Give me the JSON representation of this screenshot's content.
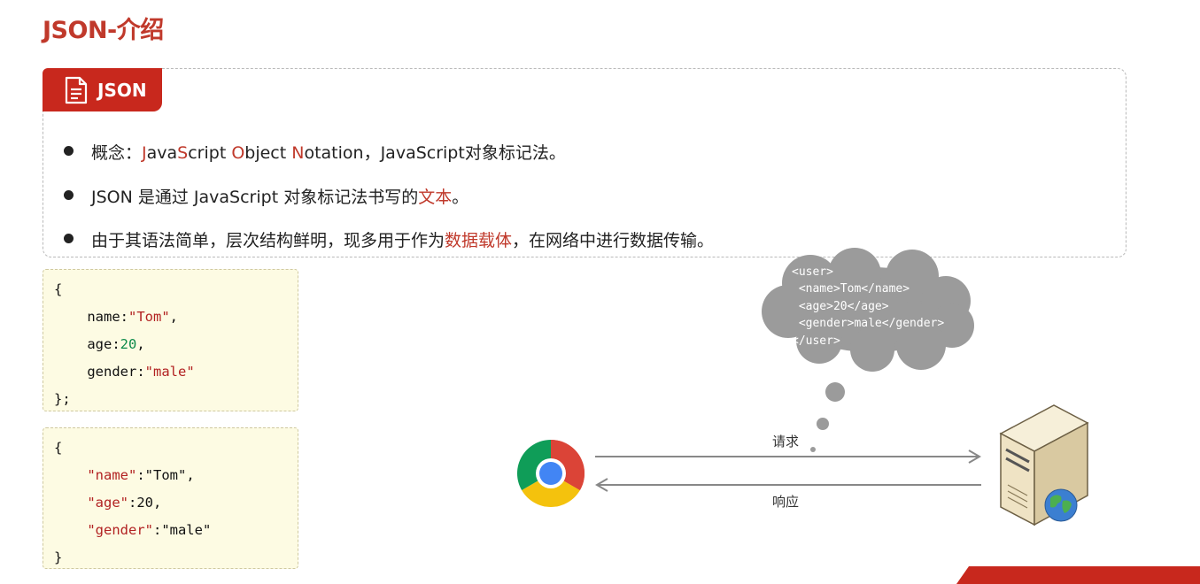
{
  "page": {
    "title": "JSON-介绍"
  },
  "concept_card": {
    "tag_label": "JSON",
    "tag_icon": "document-icon",
    "accent_color": "#c8281d",
    "bullets": [
      {
        "parts": [
          {
            "text": "概念：",
            "red": false
          },
          {
            "text": "J",
            "red": true
          },
          {
            "text": "ava",
            "red": false
          },
          {
            "text": "S",
            "red": true
          },
          {
            "text": "cript ",
            "red": false
          },
          {
            "text": "O",
            "red": true
          },
          {
            "text": "bject ",
            "red": false
          },
          {
            "text": "N",
            "red": true
          },
          {
            "text": "otation，JavaScript对象标记法。",
            "red": false
          }
        ]
      },
      {
        "parts": [
          {
            "text": "JSON 是通过 JavaScript 对象标记法书写的",
            "red": false
          },
          {
            "text": "文本",
            "red": true
          },
          {
            "text": "。",
            "red": false
          }
        ]
      },
      {
        "parts": [
          {
            "text": "由于其语法简单，层次结构鲜明，现多用于作为",
            "red": false
          },
          {
            "text": "数据载体",
            "red": true
          },
          {
            "text": "，在网络中进行数据传输。",
            "red": false
          }
        ]
      }
    ]
  },
  "js_object_code": {
    "lines": [
      [
        {
          "t": "{",
          "c": "plain"
        }
      ],
      [
        {
          "t": "    name:",
          "c": "plain"
        },
        {
          "t": "\"Tom\"",
          "c": "str"
        },
        {
          "t": ",",
          "c": "plain"
        }
      ],
      [
        {
          "t": "    age:",
          "c": "plain"
        },
        {
          "t": "20",
          "c": "num"
        },
        {
          "t": ",",
          "c": "plain"
        }
      ],
      [
        {
          "t": "    gender:",
          "c": "plain"
        },
        {
          "t": "\"male\"",
          "c": "str"
        }
      ],
      [
        {
          "t": "};",
          "c": "plain"
        }
      ]
    ]
  },
  "json_code": {
    "lines": [
      [
        {
          "t": "{",
          "c": "plain"
        }
      ],
      [
        {
          "t": "    ",
          "c": "plain"
        },
        {
          "t": "\"name\"",
          "c": "str"
        },
        {
          "t": ":\"Tom\",",
          "c": "plain"
        }
      ],
      [
        {
          "t": "    ",
          "c": "plain"
        },
        {
          "t": "\"age\"",
          "c": "str"
        },
        {
          "t": ":20,",
          "c": "plain"
        }
      ],
      [
        {
          "t": "    ",
          "c": "plain"
        },
        {
          "t": "\"gender\"",
          "c": "str"
        },
        {
          "t": ":\"male\"",
          "c": "plain"
        }
      ],
      [
        {
          "t": "}",
          "c": "plain"
        }
      ]
    ]
  },
  "diagram": {
    "xml_cloud_text": "<user>\n <name>Tom</name>\n <age>20</age>\n <gender>male</gender>\n</user>",
    "request_label": "请求",
    "response_label": "响应",
    "client_icon": "chrome-browser-icon",
    "server_icon": "server-globe-icon"
  }
}
